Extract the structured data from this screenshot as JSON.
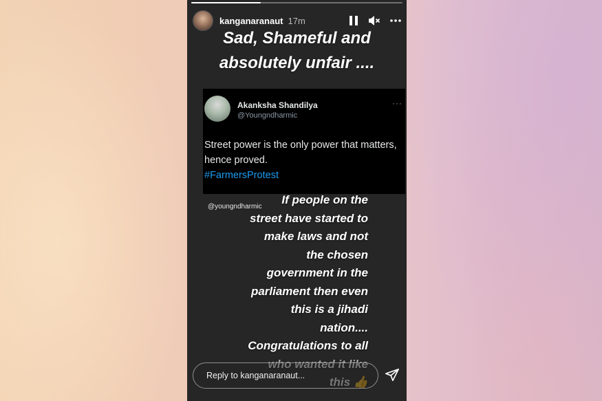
{
  "story": {
    "username": "kanganaranaut",
    "time": "17m",
    "progress": 0.33,
    "headline": [
      "Sad, Shameful and",
      "absolutely unfair ...."
    ],
    "tweet": {
      "name": "Akanksha Shandilya",
      "handle": "@Youngndharmic",
      "more": "···",
      "body": "Street power is the only power that matters, hence proved.",
      "hashtag": "#FarmersProtest"
    },
    "mention": "@youngndharmic",
    "comment_lines": [
      "If people on the",
      "street have started to",
      "make laws and not",
      "the chosen",
      "government in the",
      "parliament then even",
      "this is a jihadi",
      "nation....",
      "Congratulations to all",
      "who wanted it like",
      "this 👍"
    ],
    "reply_placeholder": "Reply to kanganaranaut...",
    "icons": {
      "pause": "pause-icon",
      "mute": "speaker-muted-icon",
      "more": "more-icon",
      "send": "send-icon"
    }
  }
}
